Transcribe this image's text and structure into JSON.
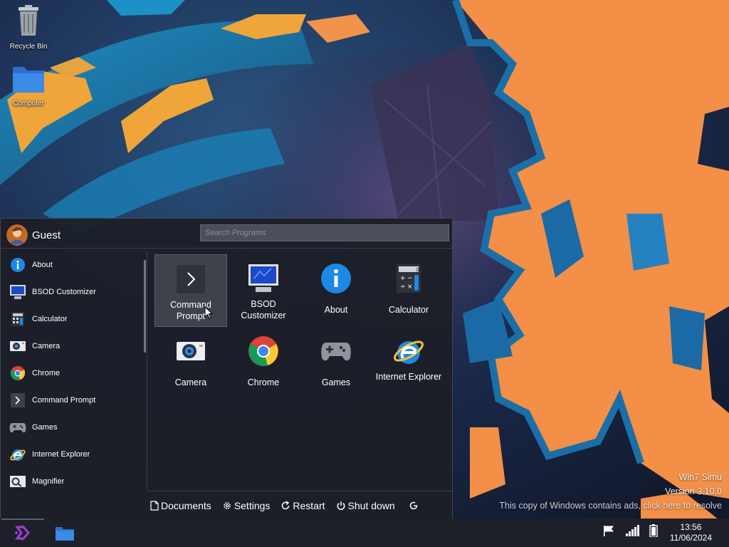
{
  "desktop": {
    "icons": [
      {
        "label": "Recycle Bin",
        "icon": "recycle-bin-icon"
      },
      {
        "label": "Computer",
        "icon": "folder-icon"
      }
    ]
  },
  "watermark": {
    "line1": "Win7 Simu",
    "line2": "Version 3.10.0",
    "line3": "This copy of Windows contains ads, click here to resolve"
  },
  "start_menu": {
    "user": {
      "name": "Guest",
      "avatar": "user-avatar-icon"
    },
    "search": {
      "placeholder": "Search Programs"
    },
    "list": [
      {
        "label": "About",
        "icon": "info-icon"
      },
      {
        "label": "BSOD Customizer",
        "icon": "monitor-icon"
      },
      {
        "label": "Calculator",
        "icon": "calculator-icon"
      },
      {
        "label": "Camera",
        "icon": "camera-icon"
      },
      {
        "label": "Chrome",
        "icon": "chrome-icon"
      },
      {
        "label": "Command Prompt",
        "icon": "command-prompt-icon"
      },
      {
        "label": "Games",
        "icon": "gamepad-icon"
      },
      {
        "label": "Internet Explorer",
        "icon": "internet-explorer-icon"
      },
      {
        "label": "Magnifier",
        "icon": "magnifier-icon"
      }
    ],
    "tiles": [
      {
        "label": "Command Prompt",
        "icon": "command-prompt-icon",
        "selected": true
      },
      {
        "label": "BSOD Customizer",
        "icon": "monitor-icon"
      },
      {
        "label": "About",
        "icon": "info-icon"
      },
      {
        "label": "Calculator",
        "icon": "calculator-icon"
      },
      {
        "label": "Camera",
        "icon": "camera-icon"
      },
      {
        "label": "Chrome",
        "icon": "chrome-icon"
      },
      {
        "label": "Games",
        "icon": "gamepad-icon"
      },
      {
        "label": "Internet Explorer",
        "icon": "internet-explorer-icon"
      }
    ],
    "actions": {
      "documents": "Documents",
      "settings": "Settings",
      "restart": "Restart",
      "shutdown": "Shut down"
    }
  },
  "taskbar": {
    "start_icon": "start-logo-icon",
    "pinned_icon": "folder-icon",
    "tray_icons": [
      "flag-icon",
      "signal-icon",
      "battery-icon"
    ],
    "time": "13:56",
    "date": "11/06/2024"
  },
  "colors": {
    "accent_blue": "#1f88e5",
    "start_purple": "#9b3fd1",
    "wallpaper_orange": "#f28c3e",
    "wallpaper_teal": "#1a8fc4"
  }
}
